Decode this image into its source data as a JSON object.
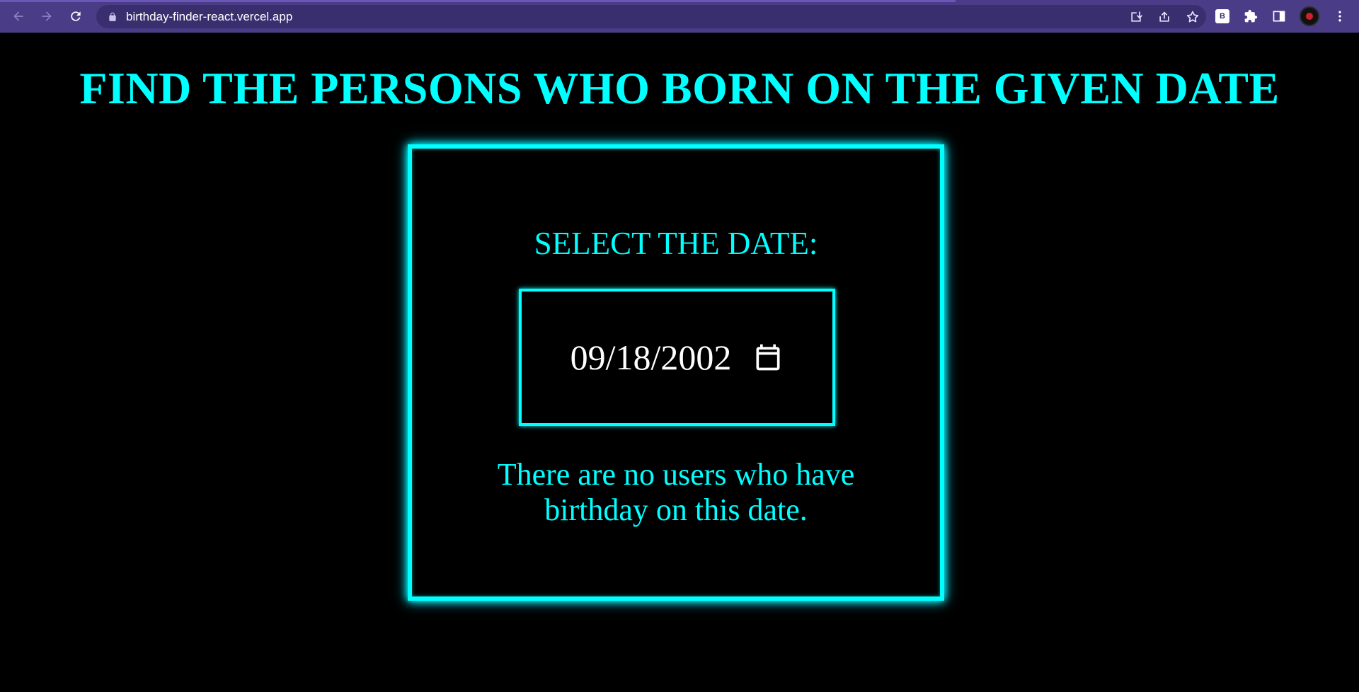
{
  "browser": {
    "url": "birthday-finder-react.vercel.app",
    "extension_label": "B",
    "accent": "#4a3c86"
  },
  "page": {
    "title": "FIND THE PERSONS WHO BORN ON THE GIVEN DATE",
    "select_label": "SELECT THE DATE:",
    "date_value": "09/18/2002",
    "message_line1": "There are no users who have",
    "message_line2": "birthday on this date.",
    "accent": "#00ffff",
    "background": "#000000"
  }
}
